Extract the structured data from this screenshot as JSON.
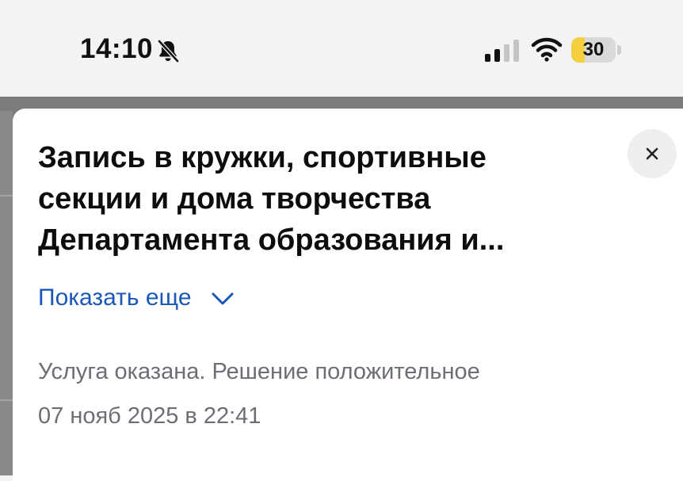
{
  "status_bar": {
    "time": "14:10",
    "icons": [
      "bell-off-icon",
      "signal-icon",
      "wifi-icon"
    ],
    "battery_level": "30",
    "battery_fraction": 0.3,
    "battery_color": "#f4cf3f"
  },
  "sheet": {
    "title": "Запись в кружки, спортивные секции и дома творчества Департамента образования и...",
    "close_icon": "close-icon",
    "show_more_label": "Показать еще",
    "show_more_icon": "chevron-down-icon",
    "status_text": "Услуга оказана. Решение положительное",
    "date_text": "07 нояб 2025 в 22:41",
    "link_color": "#1a57b8"
  }
}
